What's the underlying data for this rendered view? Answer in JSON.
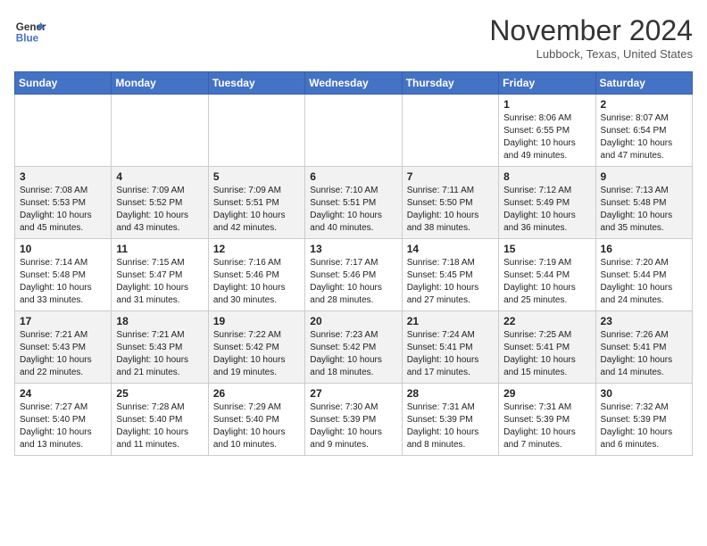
{
  "header": {
    "logo_line1": "General",
    "logo_line2": "Blue",
    "month": "November 2024",
    "location": "Lubbock, Texas, United States"
  },
  "weekdays": [
    "Sunday",
    "Monday",
    "Tuesday",
    "Wednesday",
    "Thursday",
    "Friday",
    "Saturday"
  ],
  "weeks": [
    [
      {
        "day": "",
        "info": ""
      },
      {
        "day": "",
        "info": ""
      },
      {
        "day": "",
        "info": ""
      },
      {
        "day": "",
        "info": ""
      },
      {
        "day": "",
        "info": ""
      },
      {
        "day": "1",
        "info": "Sunrise: 8:06 AM\nSunset: 6:55 PM\nDaylight: 10 hours and 49 minutes."
      },
      {
        "day": "2",
        "info": "Sunrise: 8:07 AM\nSunset: 6:54 PM\nDaylight: 10 hours and 47 minutes."
      }
    ],
    [
      {
        "day": "3",
        "info": "Sunrise: 7:08 AM\nSunset: 5:53 PM\nDaylight: 10 hours and 45 minutes."
      },
      {
        "day": "4",
        "info": "Sunrise: 7:09 AM\nSunset: 5:52 PM\nDaylight: 10 hours and 43 minutes."
      },
      {
        "day": "5",
        "info": "Sunrise: 7:09 AM\nSunset: 5:51 PM\nDaylight: 10 hours and 42 minutes."
      },
      {
        "day": "6",
        "info": "Sunrise: 7:10 AM\nSunset: 5:51 PM\nDaylight: 10 hours and 40 minutes."
      },
      {
        "day": "7",
        "info": "Sunrise: 7:11 AM\nSunset: 5:50 PM\nDaylight: 10 hours and 38 minutes."
      },
      {
        "day": "8",
        "info": "Sunrise: 7:12 AM\nSunset: 5:49 PM\nDaylight: 10 hours and 36 minutes."
      },
      {
        "day": "9",
        "info": "Sunrise: 7:13 AM\nSunset: 5:48 PM\nDaylight: 10 hours and 35 minutes."
      }
    ],
    [
      {
        "day": "10",
        "info": "Sunrise: 7:14 AM\nSunset: 5:48 PM\nDaylight: 10 hours and 33 minutes."
      },
      {
        "day": "11",
        "info": "Sunrise: 7:15 AM\nSunset: 5:47 PM\nDaylight: 10 hours and 31 minutes."
      },
      {
        "day": "12",
        "info": "Sunrise: 7:16 AM\nSunset: 5:46 PM\nDaylight: 10 hours and 30 minutes."
      },
      {
        "day": "13",
        "info": "Sunrise: 7:17 AM\nSunset: 5:46 PM\nDaylight: 10 hours and 28 minutes."
      },
      {
        "day": "14",
        "info": "Sunrise: 7:18 AM\nSunset: 5:45 PM\nDaylight: 10 hours and 27 minutes."
      },
      {
        "day": "15",
        "info": "Sunrise: 7:19 AM\nSunset: 5:44 PM\nDaylight: 10 hours and 25 minutes."
      },
      {
        "day": "16",
        "info": "Sunrise: 7:20 AM\nSunset: 5:44 PM\nDaylight: 10 hours and 24 minutes."
      }
    ],
    [
      {
        "day": "17",
        "info": "Sunrise: 7:21 AM\nSunset: 5:43 PM\nDaylight: 10 hours and 22 minutes."
      },
      {
        "day": "18",
        "info": "Sunrise: 7:21 AM\nSunset: 5:43 PM\nDaylight: 10 hours and 21 minutes."
      },
      {
        "day": "19",
        "info": "Sunrise: 7:22 AM\nSunset: 5:42 PM\nDaylight: 10 hours and 19 minutes."
      },
      {
        "day": "20",
        "info": "Sunrise: 7:23 AM\nSunset: 5:42 PM\nDaylight: 10 hours and 18 minutes."
      },
      {
        "day": "21",
        "info": "Sunrise: 7:24 AM\nSunset: 5:41 PM\nDaylight: 10 hours and 17 minutes."
      },
      {
        "day": "22",
        "info": "Sunrise: 7:25 AM\nSunset: 5:41 PM\nDaylight: 10 hours and 15 minutes."
      },
      {
        "day": "23",
        "info": "Sunrise: 7:26 AM\nSunset: 5:41 PM\nDaylight: 10 hours and 14 minutes."
      }
    ],
    [
      {
        "day": "24",
        "info": "Sunrise: 7:27 AM\nSunset: 5:40 PM\nDaylight: 10 hours and 13 minutes."
      },
      {
        "day": "25",
        "info": "Sunrise: 7:28 AM\nSunset: 5:40 PM\nDaylight: 10 hours and 11 minutes."
      },
      {
        "day": "26",
        "info": "Sunrise: 7:29 AM\nSunset: 5:40 PM\nDaylight: 10 hours and 10 minutes."
      },
      {
        "day": "27",
        "info": "Sunrise: 7:30 AM\nSunset: 5:39 PM\nDaylight: 10 hours and 9 minutes."
      },
      {
        "day": "28",
        "info": "Sunrise: 7:31 AM\nSunset: 5:39 PM\nDaylight: 10 hours and 8 minutes."
      },
      {
        "day": "29",
        "info": "Sunrise: 7:31 AM\nSunset: 5:39 PM\nDaylight: 10 hours and 7 minutes."
      },
      {
        "day": "30",
        "info": "Sunrise: 7:32 AM\nSunset: 5:39 PM\nDaylight: 10 hours and 6 minutes."
      }
    ]
  ]
}
